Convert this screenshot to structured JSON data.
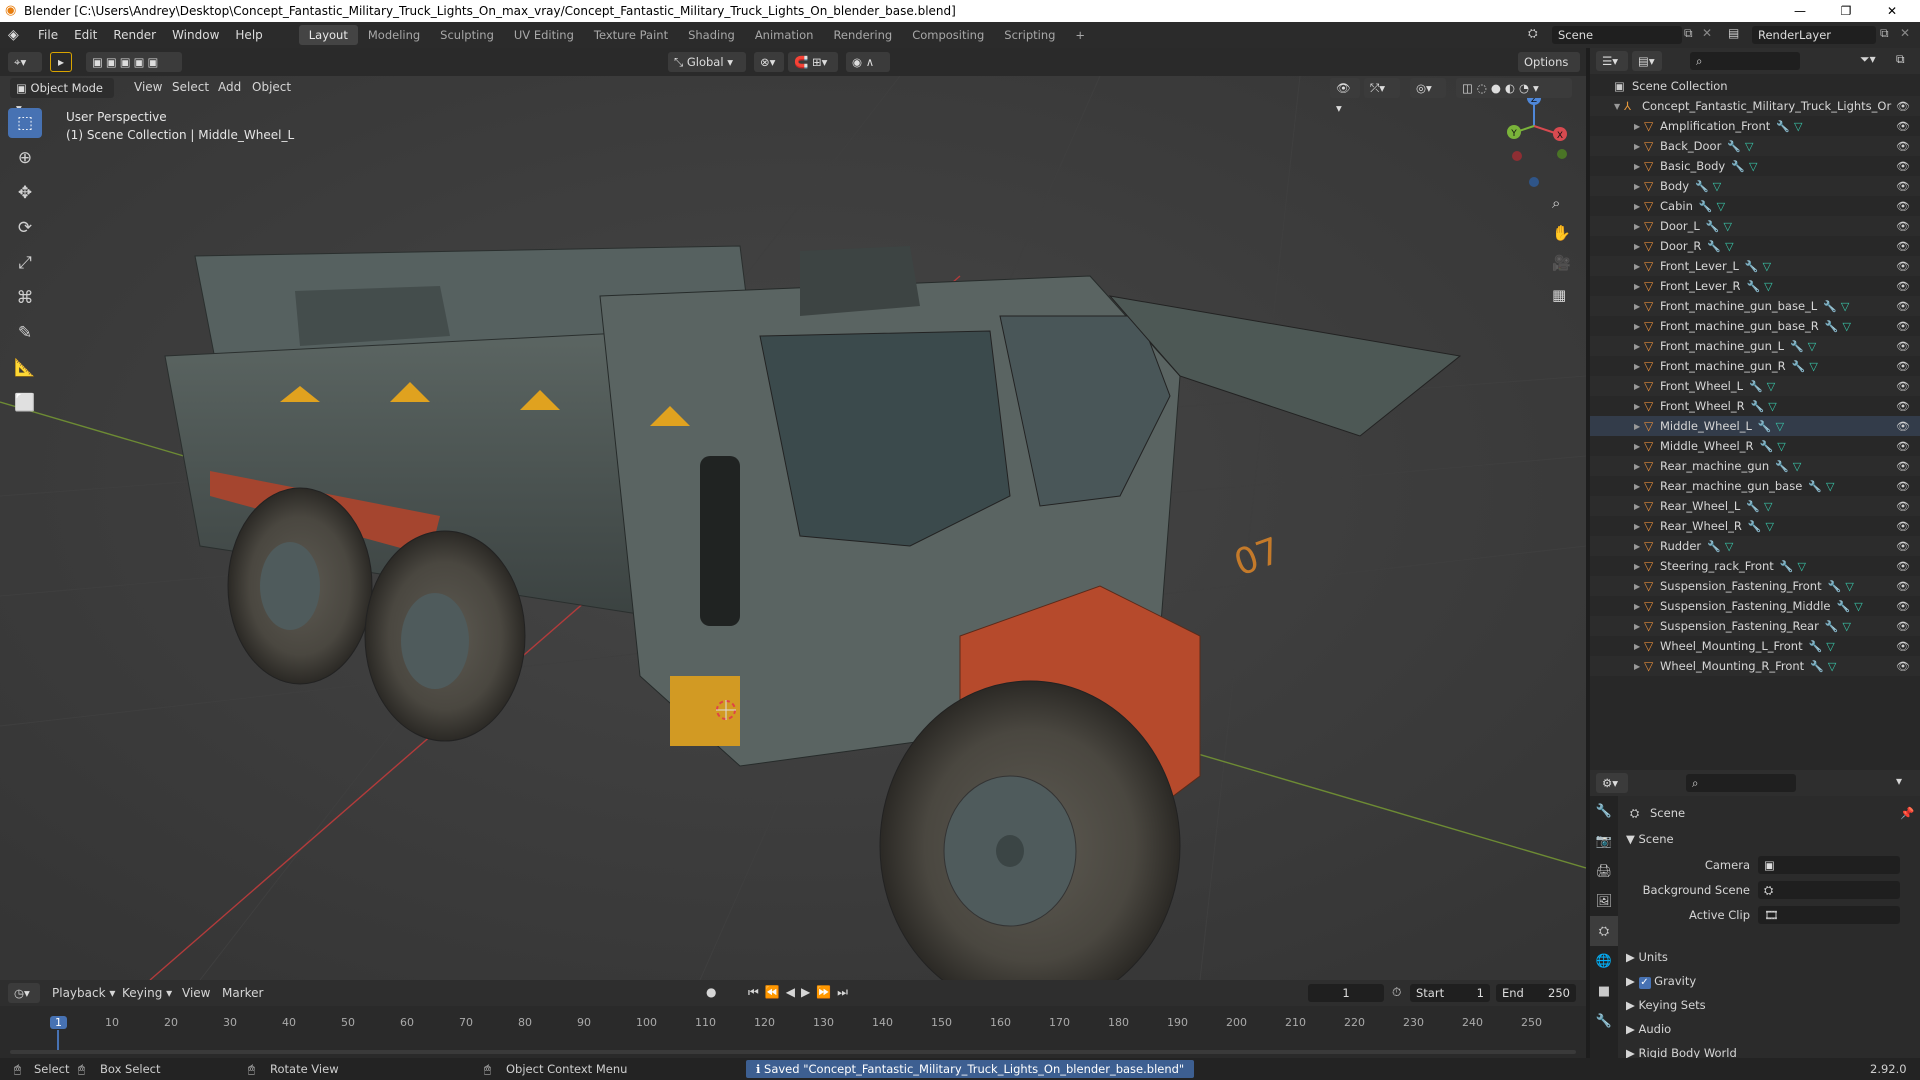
{
  "window": {
    "title": "Blender [C:\\Users\\Andrey\\Desktop\\Concept_Fantastic_Military_Truck_Lights_On_max_vray/Concept_Fantastic_Military_Truck_Lights_On_blender_base.blend]",
    "min": "—",
    "max": "❐",
    "close": "✕"
  },
  "menu": [
    "File",
    "Edit",
    "Render",
    "Window",
    "Help"
  ],
  "workspaces": [
    "Layout",
    "Modeling",
    "Sculpting",
    "UV Editing",
    "Texture Paint",
    "Shading",
    "Animation",
    "Rendering",
    "Compositing",
    "Scripting"
  ],
  "add_tab": "+",
  "scene_field": "Scene",
  "renderlayer_field": "RenderLayer",
  "viewport": {
    "mode": "Object Mode",
    "menus": [
      "View",
      "Select",
      "Add",
      "Object"
    ],
    "transform": "Global",
    "options": "Options",
    "overlay1": "User Perspective",
    "overlay2": "(1) Scene Collection | Middle_Wheel_L",
    "gizmo": {
      "x": "X",
      "y": "Y",
      "z": "Z"
    },
    "car_number": "07"
  },
  "outliner": {
    "root": "Scene Collection",
    "collection": "Concept_Fantastic_Military_Truck_Lights_Or",
    "selected": "Middle_Wheel_L",
    "items": [
      "Amplification_Front",
      "Back_Door",
      "Basic_Body",
      "Body",
      "Cabin",
      "Door_L",
      "Door_R",
      "Front_Lever_L",
      "Front_Lever_R",
      "Front_machine_gun_base_L",
      "Front_machine_gun_base_R",
      "Front_machine_gun_L",
      "Front_machine_gun_R",
      "Front_Wheel_L",
      "Front_Wheel_R",
      "Middle_Wheel_L",
      "Middle_Wheel_R",
      "Rear_machine_gun",
      "Rear_machine_gun_base",
      "Rear_Wheel_L",
      "Rear_Wheel_R",
      "Rudder",
      "Steering_rack_Front",
      "Suspension_Fastening_Front",
      "Suspension_Fastening_Middle",
      "Suspension_Fastening_Rear",
      "Wheel_Mounting_L_Front",
      "Wheel_Mounting_R_Front"
    ]
  },
  "properties": {
    "context": "Scene",
    "panel": "Scene",
    "camera_label": "Camera",
    "bgscene_label": "Background Scene",
    "activeclip_label": "Active Clip",
    "sections": [
      "Units",
      "Gravity",
      "Keying Sets",
      "Audio",
      "Rigid Body World"
    ],
    "gravity_checked": true
  },
  "timeline": {
    "menus": [
      "Playback",
      "Keying",
      "View",
      "Marker"
    ],
    "current_frame": "1",
    "start_label": "Start",
    "start": "1",
    "end_label": "End",
    "end": "250",
    "ticks": [
      "1",
      "10",
      "20",
      "30",
      "40",
      "50",
      "60",
      "70",
      "80",
      "90",
      "100",
      "110",
      "120",
      "130",
      "140",
      "150",
      "160",
      "170",
      "180",
      "190",
      "200",
      "210",
      "220",
      "230",
      "240",
      "250"
    ]
  },
  "status": {
    "select": "Select",
    "box_select": "Box Select",
    "rotate": "Rotate View",
    "context_menu": "Object Context Menu",
    "message": "Saved \"Concept_Fantastic_Military_Truck_Lights_On_blender_base.blend\"",
    "version": "2.92.0"
  }
}
